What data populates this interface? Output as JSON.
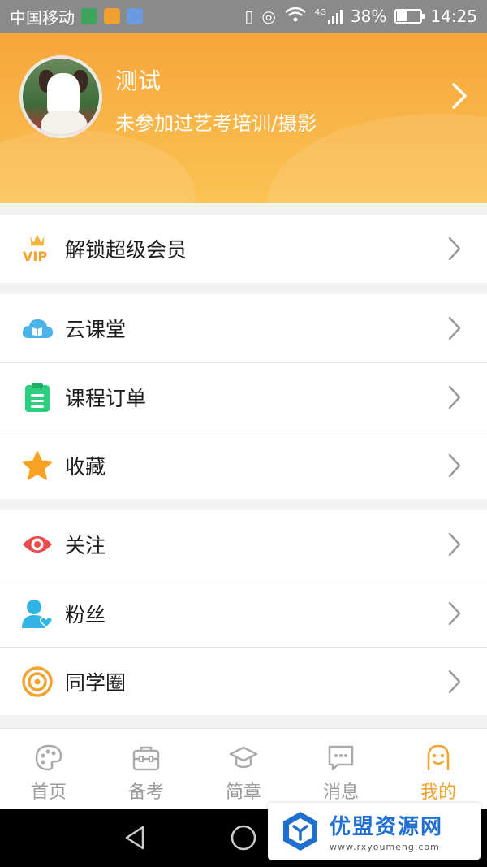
{
  "status_bar": {
    "carrier": "中国移动",
    "network": "4G",
    "battery_percent": "38%",
    "battery_level": 0.38,
    "time": "14:25"
  },
  "profile": {
    "name": "测试",
    "description": "未参加过艺考培训/摄影"
  },
  "menu_groups": [
    [
      {
        "label": "解锁超级会员",
        "icon": "vip-crown-icon"
      }
    ],
    [
      {
        "label": "云课堂",
        "icon": "cloud-book-icon"
      },
      {
        "label": "课程订单",
        "icon": "clipboard-icon"
      },
      {
        "label": "收藏",
        "icon": "star-icon"
      }
    ],
    [
      {
        "label": "关注",
        "icon": "eye-icon"
      },
      {
        "label": "粉丝",
        "icon": "user-heart-icon"
      },
      {
        "label": "同学圈",
        "icon": "circle-swirl-icon"
      }
    ]
  ],
  "tabbar": {
    "tabs": [
      {
        "label": "首页",
        "icon": "palette-icon"
      },
      {
        "label": "备考",
        "icon": "briefcase-icon"
      },
      {
        "label": "简章",
        "icon": "graduation-cap-icon"
      },
      {
        "label": "消息",
        "icon": "chat-bubble-icon"
      },
      {
        "label": "我的",
        "icon": "smiley-icon"
      }
    ],
    "active_index": 4
  },
  "watermark": {
    "title": "优盟资源网",
    "url": "www.rxyoumeng.com"
  },
  "colors": {
    "accent": "#f2a22e",
    "header_top": "#f6a53a",
    "header_bottom": "#fbc355"
  }
}
